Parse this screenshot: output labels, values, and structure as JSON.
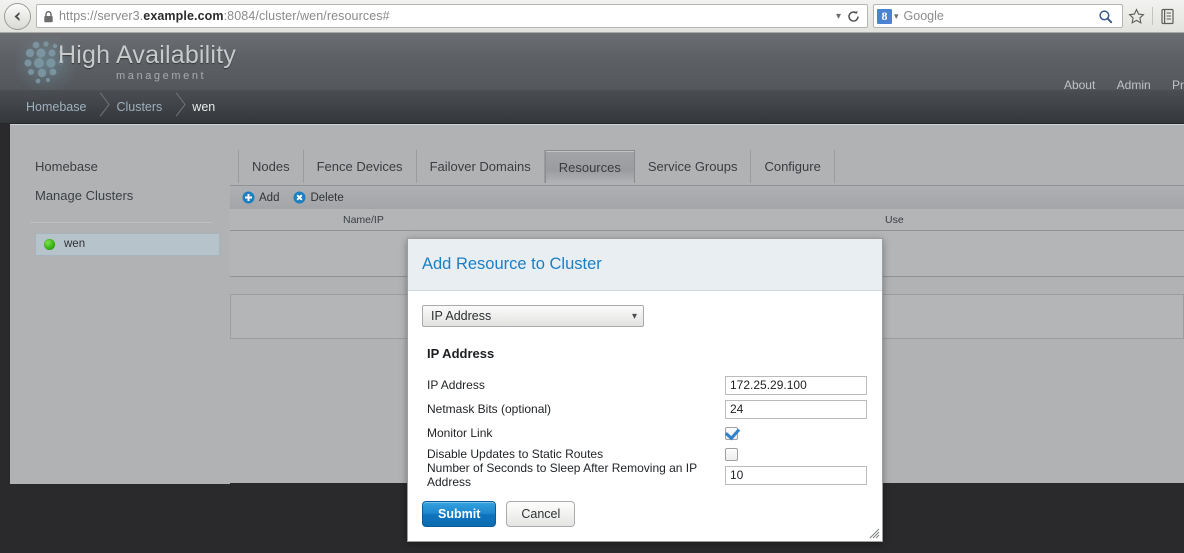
{
  "browser": {
    "back_icon": "back-arrow-icon",
    "lock_icon": "padlock-icon",
    "url_prefix": "https://server3.",
    "url_domain": "example.com",
    "url_suffix": ":8084/cluster/wen/resources#",
    "url_full": "https://server3.example.com:8084/cluster/wen/resources#",
    "url_dropdown_icon": "chevron-down-icon",
    "reload_icon": "reload-icon",
    "search_engine_logo": "8",
    "search_placeholder": "Google",
    "search_icon": "magnifier-icon",
    "bookmark_icon": "star-icon",
    "library_icon": "reading-list-icon"
  },
  "header": {
    "brand": "High Availability",
    "subtitle": "management",
    "logo_icon": "dot-cluster-logo",
    "links": [
      "About",
      "Admin",
      "Pr"
    ]
  },
  "breadcrumb": {
    "items": [
      {
        "label": "Homebase",
        "current": false
      },
      {
        "label": "Clusters",
        "current": false
      },
      {
        "label": "wen",
        "current": true
      }
    ]
  },
  "sidebar": {
    "items": [
      {
        "label": "Homebase"
      },
      {
        "label": "Manage Clusters"
      }
    ],
    "clusters": [
      {
        "label": "wen",
        "status_color": "#3cb518",
        "selected": true
      }
    ]
  },
  "tabs": [
    {
      "label": "Nodes",
      "active": false
    },
    {
      "label": "Fence Devices",
      "active": false
    },
    {
      "label": "Failover Domains",
      "active": false
    },
    {
      "label": "Resources",
      "active": true
    },
    {
      "label": "Service Groups",
      "active": false
    },
    {
      "label": "Configure",
      "active": false
    }
  ],
  "toolbar": {
    "add_label": "Add",
    "add_icon": "plus-circle-icon",
    "delete_label": "Delete",
    "delete_icon": "x-circle-icon"
  },
  "table": {
    "columns": [
      "Name/IP",
      "Use"
    ],
    "rows": []
  },
  "dialog": {
    "title": "Add Resource to Cluster",
    "resource_type": {
      "selected": "IP Address",
      "chevron_icon": "chevron-down-icon"
    },
    "section_title": "IP Address",
    "fields": [
      {
        "label": "IP Address",
        "type": "text",
        "value": "172.25.29.100"
      },
      {
        "label": "Netmask Bits (optional)",
        "type": "text",
        "value": "24"
      },
      {
        "label": "Monitor Link",
        "type": "checkbox",
        "checked": true
      },
      {
        "label": "Disable Updates to Static Routes",
        "type": "checkbox",
        "checked": false
      },
      {
        "label": "Number of Seconds to Sleep After Removing an IP Address",
        "type": "text",
        "value": "10"
      }
    ],
    "submit_label": "Submit",
    "cancel_label": "Cancel",
    "resize_icon": "resize-grip-icon"
  },
  "colors": {
    "accent_blue": "#1b7fc4",
    "status_green": "#3cb518",
    "page_bg": "#b0b2b4",
    "chrome_dark": "#2a2a2c"
  }
}
